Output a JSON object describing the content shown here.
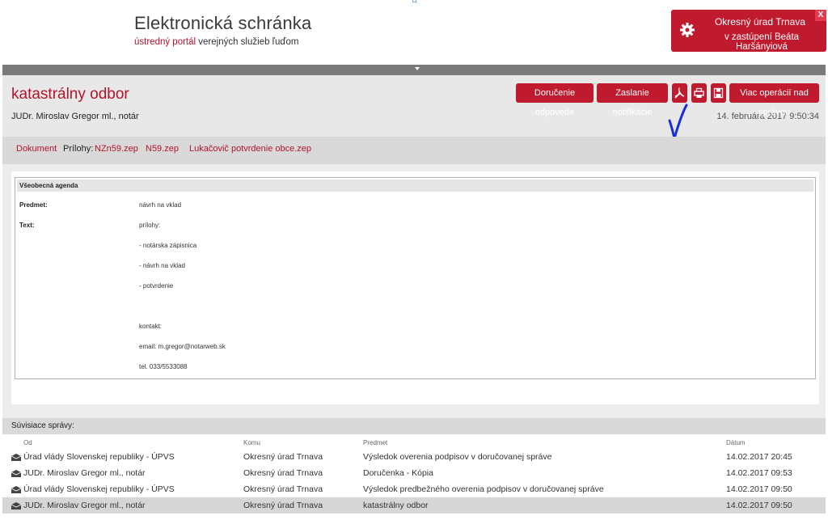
{
  "header": {
    "brand_title": "Elektronická schránka",
    "brand_sub_accent": "ústredný portál",
    "brand_sub_rest": " verejných služieb ľuďom",
    "user_line1": "Okresný úrad Trnava",
    "user_line2": "v zastúpení Beáta Haršányiová",
    "close_label": "X"
  },
  "message": {
    "title": "katastrálny odbor",
    "from": "JUDr. Miroslav Gregor ml., notár",
    "date": "14. februára 2017 9:50:34",
    "buttons": {
      "delivery": "Doručenie odpovede",
      "notify": "Zaslanie notifikácie",
      "more": "Viac operácií nad správou"
    },
    "icons": [
      "pdf-icon",
      "print-icon",
      "save-icon"
    ]
  },
  "attachments": {
    "document_link": "Dokument",
    "label": "Prílohy:",
    "files": [
      "NZn59.zep",
      "N59.zep",
      "Lukačovič potvrdenie obce.zep"
    ]
  },
  "agenda": {
    "header": "Všeobecná agenda",
    "subject_label": "Predmet:",
    "subject_value": "návrh na vklad",
    "text_label": "Text:",
    "text_lines": [
      "prílohy:",
      "- notárska zápisnica",
      "- návrh na vklad",
      "- potvrdenie",
      "kontakt:",
      "email: m.gregor@notarweb.sk",
      "tel. 033/5533088"
    ]
  },
  "related": {
    "title": "Súvisiace správy:",
    "columns": [
      "Od",
      "Komu",
      "Predmet",
      "Dátum"
    ],
    "rows": [
      {
        "from": "Úrad vlády Slovenskej republiky - ÚPVS",
        "to": "Okresný úrad Trnava",
        "subject": "Výsledok overenia podpisov v doručovanej správe",
        "date": "14.02.2017 20:45"
      },
      {
        "from": "JUDr. Miroslav Gregor ml., notár",
        "to": "Okresný úrad Trnava",
        "subject": "Doručenka - Kópia",
        "date": "14.02.2017 09:53"
      },
      {
        "from": "Úrad vlády Slovenskej republiky - ÚPVS",
        "to": "Okresný úrad Trnava",
        "subject": "Výsledok predbežného overenia podpisov v doručovanej správe",
        "date": "14.02.2017 09:50"
      },
      {
        "from": "JUDr. Miroslav Gregor ml., notár",
        "to": "Okresný úrad Trnava",
        "subject": "katastrálny odbor",
        "date": "14.02.2017 09:50"
      }
    ]
  },
  "colors": {
    "accent": "#c01a2f",
    "link": "#b3142b",
    "annotation_check": "#1a2fd6"
  }
}
